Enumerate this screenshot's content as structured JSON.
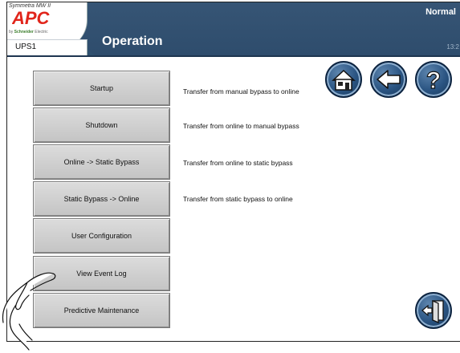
{
  "header": {
    "product_name": "Symmetra MW II",
    "brand_logo": "APC",
    "brand_by_prefix": "by",
    "brand_by_name": "Schneider",
    "brand_by_suffix": "Electric",
    "device_name": "UPS1",
    "page_title": "Operation",
    "status": "Normal",
    "clock": "13:2"
  },
  "menu": [
    {
      "label": "Startup",
      "description": "Transfer from manual bypass to online"
    },
    {
      "label": "Shutdown",
      "description": "Transfer from online to manual bypass"
    },
    {
      "label": "Online -> Static Bypass",
      "description": "Transfer from online to static bypass"
    },
    {
      "label": "Static Bypass -> Online",
      "description": "Transfer from static bypass to online"
    },
    {
      "label": "User Configuration",
      "description": ""
    },
    {
      "label": "View Event Log",
      "description": ""
    },
    {
      "label": "Predictive Maintenance",
      "description": ""
    }
  ],
  "nav_icons": {
    "home": "home-icon",
    "back": "back-arrow-icon",
    "help": "help-question-icon",
    "logout": "logout-door-icon",
    "pointer": "pointing-hand-icon"
  },
  "colors": {
    "header_bg": "#2f506f",
    "button_face": "#d0d0d0",
    "round_button": "#2a5482"
  }
}
